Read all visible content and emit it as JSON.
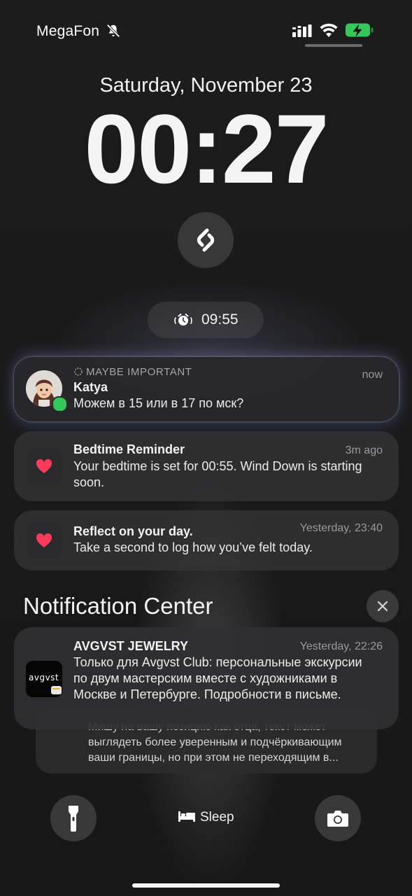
{
  "status_bar": {
    "carrier": "MegaFon"
  },
  "lock_screen": {
    "date": "Saturday, November 23",
    "time": "00:27",
    "alarm_time": "09:55"
  },
  "notifications": [
    {
      "focus_label": "MAYBE IMPORTANT",
      "title": "Katya",
      "body": "Можем в 15 или в 17 по мск?",
      "time": "now"
    },
    {
      "title": "Bedtime Reminder",
      "body": "Your bedtime is set for 00:55. Wind Down is starting soon.",
      "time": "3m ago"
    },
    {
      "title": "Reflect on your day.",
      "body": "Take a second to log how you’ve felt today.",
      "time": "Yesterday, 23:40"
    }
  ],
  "notification_center": {
    "title": "Notification Center",
    "items": [
      {
        "app_icon_text": "avgvst",
        "title": "AVGVST JEWELRY",
        "body": "Только для Avgvst Club: персональные экскурсии по двум мастерским вместе с художниками в Москве и Петербурге. Подробности в письме.",
        "time": "Yesterday, 22:26"
      }
    ],
    "stacked_preview": "Мишу на вашу позицию как отца, текст может выглядеть более уверенным и подчёркивающим ваши границы, но при этом не переходящим в..."
  },
  "bottom_bar": {
    "sleep_label": "Sleep"
  },
  "icons": [
    "bell-slash-icon",
    "signal-icon",
    "wifi-icon",
    "battery-charging-icon",
    "shazam-icon",
    "alarm-icon",
    "heart-icon",
    "close-icon",
    "flashlight-icon",
    "bed-icon",
    "camera-icon"
  ],
  "colors": {
    "battery": "#35c759",
    "heart": "#ff3b5c",
    "message_badge": "#35c759"
  }
}
